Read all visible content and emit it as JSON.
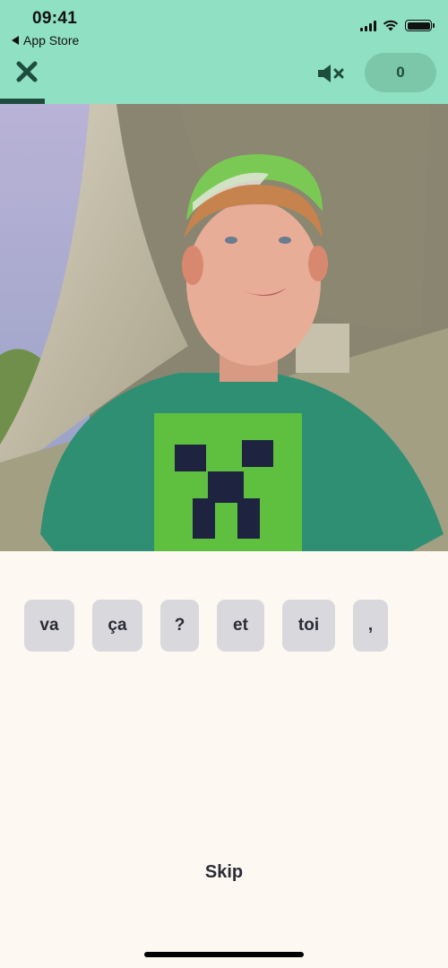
{
  "status_bar": {
    "time": "09:41",
    "back_label": "App Store"
  },
  "header": {
    "close_icon": "close-icon",
    "mute_icon": "speaker-muted-icon",
    "score": "0",
    "progress_percent": 10
  },
  "video": {
    "description": "Boy in green cap and green Minecraft Creeper t-shirt speaking to camera outdoors"
  },
  "word_tiles": [
    {
      "label": "va"
    },
    {
      "label": "ça"
    },
    {
      "label": "?"
    },
    {
      "label": "et"
    },
    {
      "label": "toi"
    },
    {
      "label": ","
    }
  ],
  "skip_label": "Skip",
  "colors": {
    "header_bg": "#90e0c4",
    "accent_dark": "#1e4d3d",
    "score_pill_bg": "#7cc7aa",
    "tile_bg": "#d9d8dd",
    "page_bg": "#fdf9f2"
  }
}
